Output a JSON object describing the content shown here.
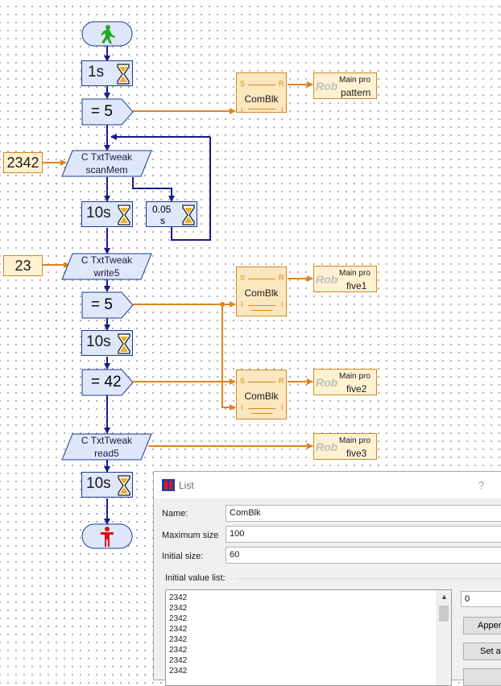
{
  "program": {
    "wait_1": "1s",
    "compare_1": "=  5",
    "input_2342": "2342",
    "txttweak_scan": {
      "line1": "C TxtTweak",
      "line2": "scanMem"
    },
    "wait_2": "10s",
    "wait_small": {
      "line1": "0.05",
      "line2": "s"
    },
    "input_23": "23",
    "txttweak_write": {
      "line1": "C TxtTweak",
      "line2": "write5"
    },
    "compare_2": "=  5",
    "wait_3": "10s",
    "compare_3": "= 42",
    "txttweak_read": {
      "line1": "C TxtTweak",
      "line2": "read5"
    },
    "wait_4": "10s"
  },
  "comblk": {
    "title": "ComBlk",
    "pin_s": "S",
    "pin_r": "R",
    "pin_i": "I"
  },
  "rob_blocks": [
    {
      "logo": "Rob",
      "main": "Main pro",
      "name": "pattern"
    },
    {
      "logo": "Rob",
      "main": "Main pro",
      "name": "five1"
    },
    {
      "logo": "Rob",
      "main": "Main pro",
      "name": "five2"
    },
    {
      "logo": "Rob",
      "main": "Main pro",
      "name": "five3"
    }
  ],
  "dialog": {
    "title": "List",
    "help": "?",
    "name_label": "Name:",
    "name_value": "ComBlk",
    "max_label": "Maximum size",
    "max_value": "100",
    "init_label": "Initial size:",
    "init_value": "60",
    "ivl_label": "Initial value list:",
    "values": [
      "2342",
      "2342",
      "2342",
      "2342",
      "2342",
      "2342",
      "2342",
      "2342"
    ],
    "side_value": "0",
    "append_label": "Append",
    "setall_label": "Set all"
  },
  "colors": {
    "flow": "#1a1a8c",
    "data": "#e0821e",
    "block_fill": "#dfe7fb",
    "orange_fill": "#fbe7bf"
  }
}
